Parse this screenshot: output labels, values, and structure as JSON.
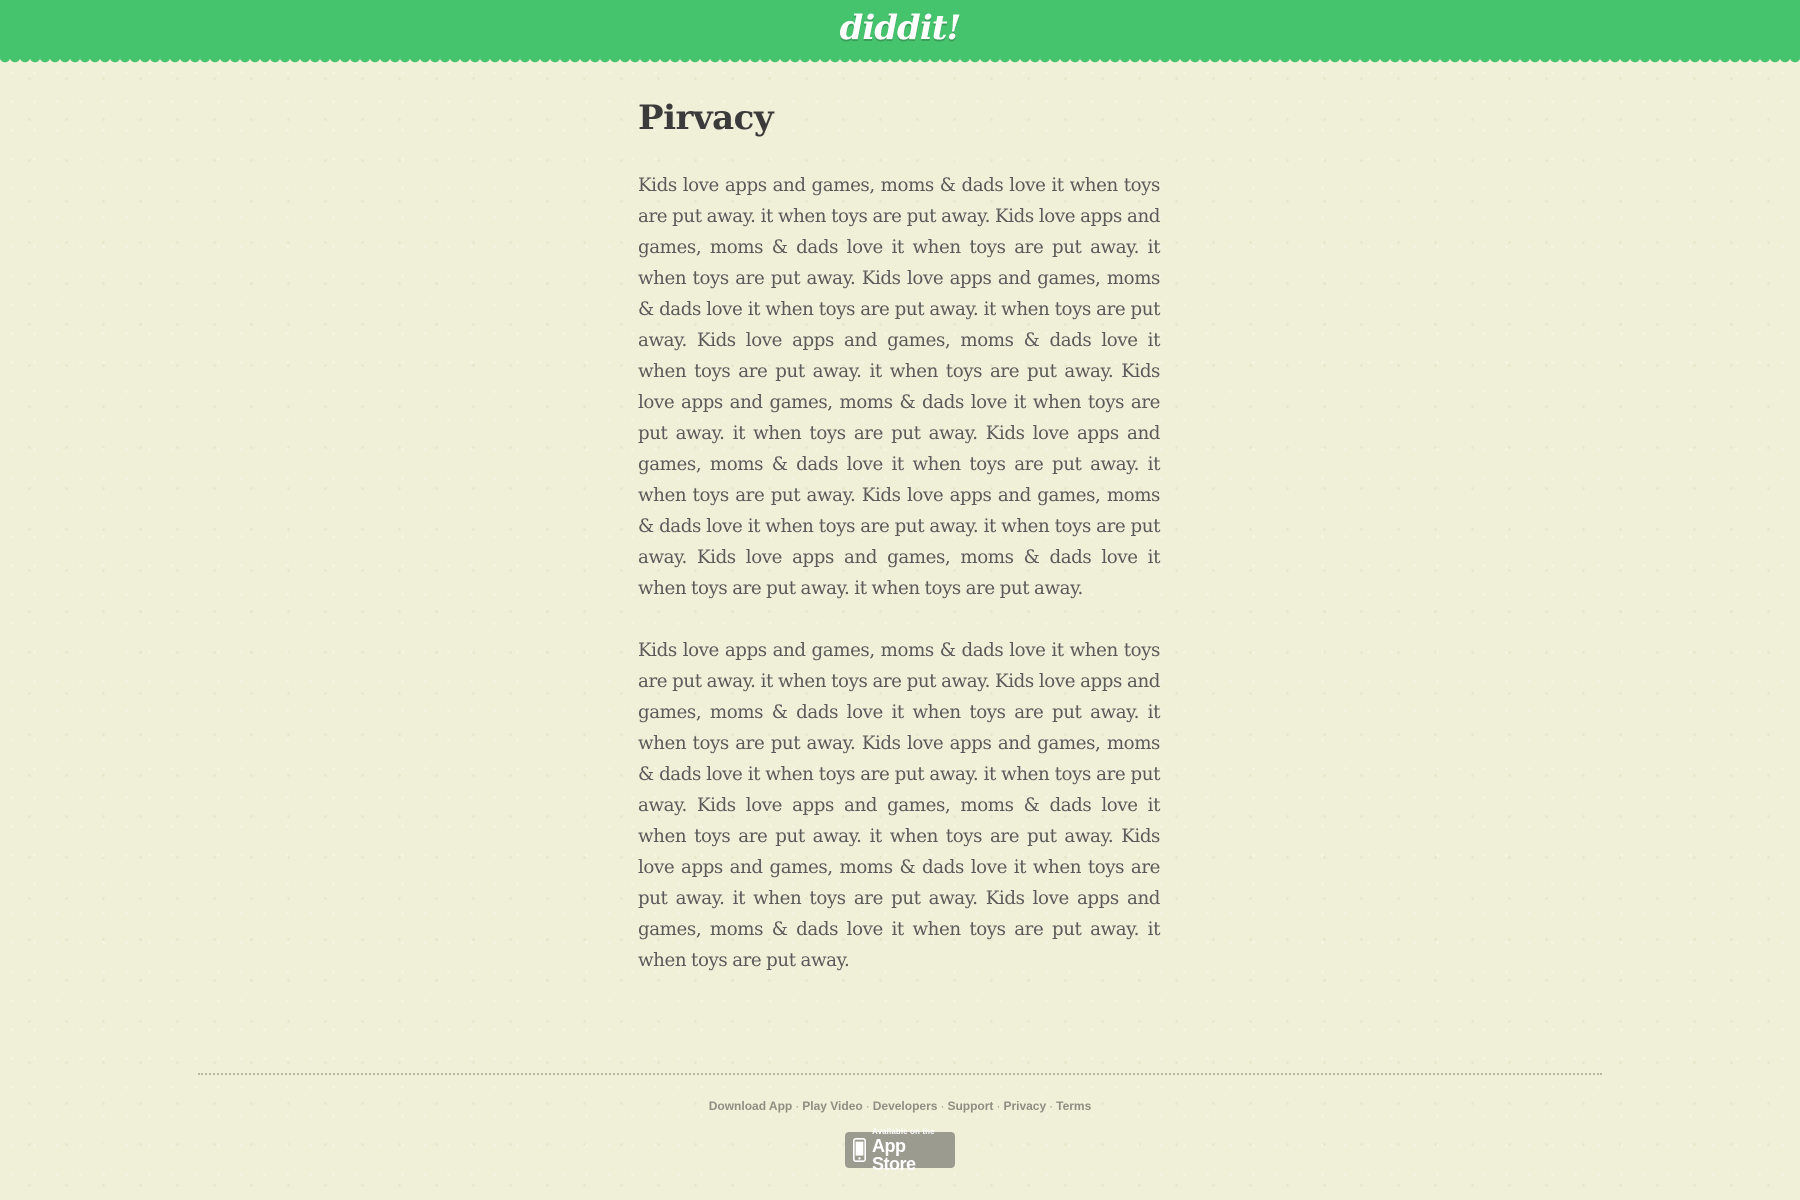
{
  "header": {
    "logo_text": "diddit!",
    "bar_color": "#45c36d"
  },
  "page": {
    "title": "Pirvacy",
    "paragraphs": [
      "Kids love apps and games, moms & dads love it when toys are put away. it when toys are put away. Kids love apps and games, moms & dads love it when toys are put away. it when toys are put away. Kids love apps and games, moms & dads love it when toys are put away. it when toys are put away. Kids love apps and games, moms & dads love it when toys are put away. it when toys are put away. Kids love apps and games, moms & dads love it when toys are put away. it when toys are put away. Kids love apps and games, moms & dads love it when toys are put away. it when toys are put away. Kids love apps and games, moms & dads love it when toys are put away. it when toys are put away. Kids love apps and games, moms & dads love it when toys are put away. it when toys are put away.",
      "Kids love apps and games, moms & dads love it when toys are put away. it when toys are put away. Kids love apps and games, moms & dads love it when toys are put away. it when toys are put away. Kids love apps and games, moms & dads love it when toys are put away. it when toys are put away. Kids love apps and games, moms & dads love it when toys are put away. it when toys are put away. Kids love apps and games, moms & dads love it when toys are put away. it when toys are put away. Kids love apps and games, moms & dads love it when toys are put away. it when toys are put away."
    ]
  },
  "footer": {
    "links": [
      {
        "label": "Download App"
      },
      {
        "label": "Play Video"
      },
      {
        "label": "Developers"
      },
      {
        "label": "Support"
      },
      {
        "label": "Privacy"
      },
      {
        "label": "Terms"
      }
    ],
    "separator": "·",
    "app_store_badge": {
      "small_text": "Available on the",
      "big_text": "App Store",
      "icon": "phone-icon"
    }
  }
}
